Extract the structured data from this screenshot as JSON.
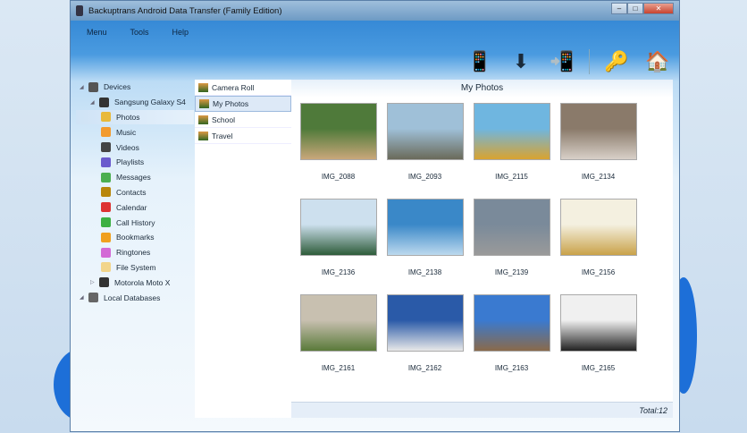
{
  "window": {
    "title": "Backuptrans Android Data Transfer (Family Edition)",
    "minimize": "–",
    "maximize": "□",
    "close": "✕"
  },
  "menu": [
    "Menu",
    "Tools",
    "Help"
  ],
  "toolbar": [
    {
      "name": "transfer-phone-to-phone",
      "glyph": "📱"
    },
    {
      "name": "backup-to-computer",
      "glyph": "⬇"
    },
    {
      "name": "restore-to-phone",
      "glyph": "📲"
    },
    {
      "name": "register-key",
      "glyph": "🔑"
    },
    {
      "name": "home",
      "glyph": "🏠"
    }
  ],
  "tree": [
    {
      "label": "Devices",
      "level": 0,
      "color": "#555"
    },
    {
      "label": "Sangsung Galaxy S4",
      "level": 1,
      "color": "#333"
    },
    {
      "label": "Photos",
      "level": 2,
      "color": "#e8b93a",
      "selected": true
    },
    {
      "label": "Music",
      "level": 2,
      "color": "#f29a2e"
    },
    {
      "label": "Videos",
      "level": 2,
      "color": "#444"
    },
    {
      "label": "Playlists",
      "level": 2,
      "color": "#6a5acd"
    },
    {
      "label": "Messages",
      "level": 2,
      "color": "#4caf50"
    },
    {
      "label": "Contacts",
      "level": 2,
      "color": "#b8860b"
    },
    {
      "label": "Calendar",
      "level": 2,
      "color": "#d33"
    },
    {
      "label": "Call History",
      "level": 2,
      "color": "#3cb043"
    },
    {
      "label": "Bookmarks",
      "level": 2,
      "color": "#f0a020"
    },
    {
      "label": "Ringtones",
      "level": 2,
      "color": "#d36ad6"
    },
    {
      "label": "File System",
      "level": 2,
      "color": "#f2d58a"
    },
    {
      "label": "Motorola Moto X",
      "level": 1,
      "color": "#333"
    },
    {
      "label": "Local Databases",
      "level": 0,
      "color": "#666"
    }
  ],
  "albums": [
    {
      "label": "Camera Roll"
    },
    {
      "label": "My Photos",
      "selected": true
    },
    {
      "label": "School"
    },
    {
      "label": "Travel"
    }
  ],
  "content": {
    "title": "My Photos",
    "total": "Total:12"
  },
  "photos": [
    {
      "name": "IMG_2088",
      "colors": [
        "#4f7a3a",
        "#c9a77a"
      ]
    },
    {
      "name": "IMG_2093",
      "colors": [
        "#9fc0d8",
        "#6a6a5a"
      ]
    },
    {
      "name": "IMG_2115",
      "colors": [
        "#6fb6e0",
        "#d9a330"
      ]
    },
    {
      "name": "IMG_2134",
      "colors": [
        "#8a7a6a",
        "#d8d0c8"
      ]
    },
    {
      "name": "IMG_2136",
      "colors": [
        "#cde0ee",
        "#2e5c3a"
      ]
    },
    {
      "name": "IMG_2138",
      "colors": [
        "#3a88c8",
        "#bcd9ee"
      ]
    },
    {
      "name": "IMG_2139",
      "colors": [
        "#7a8a9a",
        "#9a9a9a"
      ]
    },
    {
      "name": "IMG_2156",
      "colors": [
        "#f4f0e0",
        "#c9a24a"
      ]
    },
    {
      "name": "IMG_2161",
      "colors": [
        "#c8c0b0",
        "#5a7a3a"
      ]
    },
    {
      "name": "IMG_2162",
      "colors": [
        "#2a5aa8",
        "#e8e8e8"
      ]
    },
    {
      "name": "IMG_2163",
      "colors": [
        "#3a7ad0",
        "#8a6a4a"
      ]
    },
    {
      "name": "IMG_2165",
      "colors": [
        "#f0f0f0",
        "#222"
      ]
    }
  ]
}
